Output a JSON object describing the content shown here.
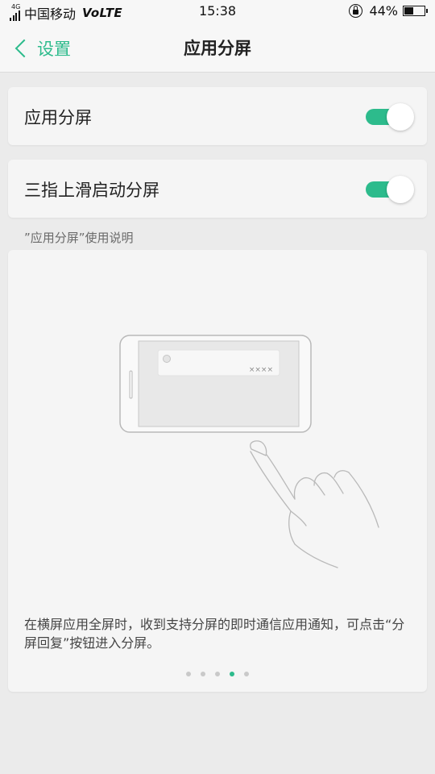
{
  "status_bar": {
    "network_badge": "4G",
    "carrier": "中国移动",
    "volte": "VoLTE",
    "time": "15:38",
    "battery_percent": "44%",
    "battery_level": 0.44,
    "icons": [
      "signal-icon",
      "rotation-lock-icon",
      "battery-icon"
    ]
  },
  "header": {
    "back_label": "设置",
    "title": "应用分屏"
  },
  "settings": [
    {
      "label": "应用分屏",
      "enabled": true
    },
    {
      "label": "三指上滑启动分屏",
      "enabled": true
    }
  ],
  "instructions": {
    "section_label": "”应用分屏”使用说明",
    "notification_text": "××××",
    "description": "在横屏应用全屏时，收到支持分屏的即时通信应用通知，可点击“分屏回复”按钮进入分屏。",
    "pager": {
      "count": 5,
      "current": 4
    }
  },
  "colors": {
    "accent": "#2dbb8c",
    "background": "#ebebeb",
    "card": "#f5f5f5"
  }
}
